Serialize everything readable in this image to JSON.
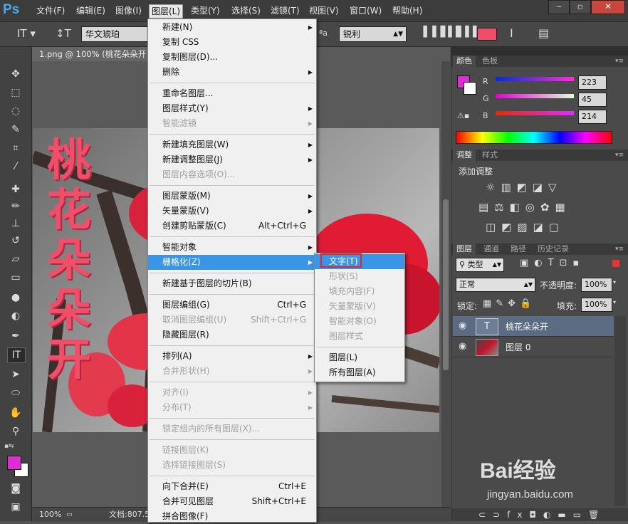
{
  "app": {
    "logo": "Ps"
  },
  "menubar": {
    "items": [
      "文件(F)",
      "编辑(E)",
      "图像(I)",
      "图层(L)",
      "类型(Y)",
      "选择(S)",
      "滤镜(T)",
      "视图(V)",
      "窗口(W)",
      "帮助(H)"
    ],
    "active_index": 3
  },
  "options_bar": {
    "font_family": "华文琥珀",
    "anti_alias_label": "ªa",
    "anti_alias_value": "锐利",
    "text_color": "#ef4e6a"
  },
  "document": {
    "tab_title": "1.png @ 100% (桃花朵朵开",
    "canvas_text": [
      "桃",
      "花",
      "朵",
      "朵",
      "开"
    ]
  },
  "status_bar": {
    "zoom": "100%",
    "doc_info": "文档:807.5"
  },
  "layer_menu": {
    "items": [
      {
        "label": "新建(N)",
        "submenu": true,
        "disabled": false
      },
      {
        "label": "复制 CSS",
        "disabled": false
      },
      {
        "label": "复制图层(D)...",
        "disabled": false
      },
      {
        "label": "删除",
        "submenu": true,
        "disabled": false
      },
      {
        "label": "重命名图层...",
        "disabled": false,
        "sep_before": true
      },
      {
        "label": "图层样式(Y)",
        "submenu": true,
        "disabled": false
      },
      {
        "label": "智能滤镜",
        "submenu": true,
        "disabled": true
      },
      {
        "label": "新建填充图层(W)",
        "submenu": true,
        "disabled": false,
        "sep_before": true
      },
      {
        "label": "新建调整图层(J)",
        "submenu": true,
        "disabled": false
      },
      {
        "label": "图层内容选项(O)...",
        "disabled": true
      },
      {
        "label": "图层蒙版(M)",
        "submenu": true,
        "disabled": false,
        "sep_before": true
      },
      {
        "label": "矢量蒙版(V)",
        "submenu": true,
        "disabled": false
      },
      {
        "label": "创建剪贴蒙版(C)",
        "shortcut": "Alt+Ctrl+G",
        "disabled": false
      },
      {
        "label": "智能对象",
        "submenu": true,
        "disabled": false,
        "sep_before": true
      },
      {
        "label": "栅格化(Z)",
        "submenu": true,
        "disabled": false,
        "highlighted": true
      },
      {
        "label": "新建基于图层的切片(B)",
        "disabled": false,
        "sep_before": true
      },
      {
        "label": "图层编组(G)",
        "shortcut": "Ctrl+G",
        "disabled": false,
        "sep_before": true
      },
      {
        "label": "取消图层编组(U)",
        "shortcut": "Shift+Ctrl+G",
        "disabled": true
      },
      {
        "label": "隐藏图层(R)",
        "disabled": false
      },
      {
        "label": "排列(A)",
        "submenu": true,
        "disabled": false,
        "sep_before": true
      },
      {
        "label": "合并形状(H)",
        "submenu": true,
        "disabled": true
      },
      {
        "label": "对齐(I)",
        "submenu": true,
        "disabled": true,
        "sep_before": true
      },
      {
        "label": "分布(T)",
        "submenu": true,
        "disabled": true
      },
      {
        "label": "锁定组内的所有图层(X)...",
        "disabled": true,
        "sep_before": true
      },
      {
        "label": "链接图层(K)",
        "disabled": true,
        "sep_before": true
      },
      {
        "label": "选择链接图层(S)",
        "disabled": true
      },
      {
        "label": "向下合并(E)",
        "shortcut": "Ctrl+E",
        "disabled": false,
        "sep_before": true
      },
      {
        "label": "合并可见图层",
        "shortcut": "Shift+Ctrl+E",
        "disabled": false
      },
      {
        "label": "拼合图像(F)",
        "disabled": false
      }
    ]
  },
  "rasterize_submenu": {
    "items": [
      {
        "label": "文字(T)",
        "highlighted": true,
        "disabled": false
      },
      {
        "label": "形状(S)",
        "disabled": true
      },
      {
        "label": "填充内容(F)",
        "disabled": true
      },
      {
        "label": "矢量蒙版(V)",
        "disabled": true
      },
      {
        "label": "智能对象(O)",
        "disabled": true
      },
      {
        "label": "图层样式",
        "disabled": true
      },
      {
        "label": "图层(L)",
        "disabled": false,
        "sep_before": true
      },
      {
        "label": "所有图层(A)",
        "disabled": false
      }
    ]
  },
  "color_panel": {
    "tabs": [
      "颜色",
      "色板"
    ],
    "r_label": "R",
    "g_label": "G",
    "b_label": "B",
    "r": 223,
    "g": 45,
    "b": 214,
    "fg_color": "#df2dd6"
  },
  "adjust_panel": {
    "tabs": [
      "调整",
      "样式"
    ],
    "title": "添加调整"
  },
  "layers_panel": {
    "tabs": [
      "图层",
      "通道",
      "路径",
      "历史记录"
    ],
    "filter_kind": "类型",
    "blend_mode": "正常",
    "opacity_label": "不透明度:",
    "opacity": "100%",
    "lock_label": "锁定:",
    "fill_label": "填充:",
    "fill": "100%",
    "layers": [
      {
        "name": "桃花朵朵开",
        "type": "text",
        "selected": true
      },
      {
        "name": "图层 0",
        "type": "image",
        "selected": false
      }
    ]
  },
  "watermark": {
    "text": "Bai经验",
    "sub": "jingyan.baidu.com"
  }
}
